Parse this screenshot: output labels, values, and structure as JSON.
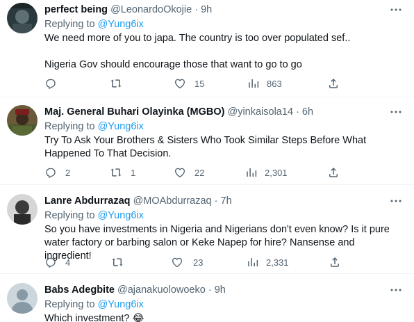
{
  "replying_label": "Replying to",
  "tweets": [
    {
      "name": "perfect being",
      "handle": "@LeonardoOkojie",
      "time": "9h",
      "reply_to": "@Yung6ix",
      "text": [
        "We need more of you to japa. The country is too over populated sef..",
        "",
        "Nigeria Gov should encourage those that want to go to go"
      ],
      "replies": "",
      "retweets": "",
      "likes": "15",
      "views": "863"
    },
    {
      "name": "Maj. General Buhari Olayinka (MGBO)",
      "handle": "@yinkaisola14",
      "time": "6h",
      "reply_to": "@Yung6ix",
      "text": [
        "Try To Ask Your Brothers & Sisters Who Took Similar Steps Before What Happened To That Decision."
      ],
      "replies": "2",
      "retweets": "1",
      "likes": "22",
      "views": "2,301"
    },
    {
      "name": "Lanre Abdurrazaq",
      "handle": "@MOAbdurrazaq",
      "time": "7h",
      "reply_to": "@Yung6ix",
      "text": [
        "So you have investments in Nigeria and Nigerians don't even know? Is it pure water factory or barbing salon or Keke Napep for hire? Nansense and ingredient!"
      ],
      "replies": "4",
      "retweets": "",
      "likes": "23",
      "views": "2,331"
    },
    {
      "name": "Babs Adegbite",
      "handle": "@ajanakuolowoeko",
      "time": "9h",
      "reply_to": "@Yung6ix",
      "text": [
        "Which investment? 😂"
      ]
    }
  ],
  "icons": {
    "reply": "reply-icon",
    "retweet": "retweet-icon",
    "like": "heart-icon",
    "views": "views-icon",
    "share": "share-icon",
    "more": "more-icon"
  },
  "colors": {
    "link": "#1d9bf0",
    "secondary": "#536471",
    "text": "#0f1419"
  }
}
